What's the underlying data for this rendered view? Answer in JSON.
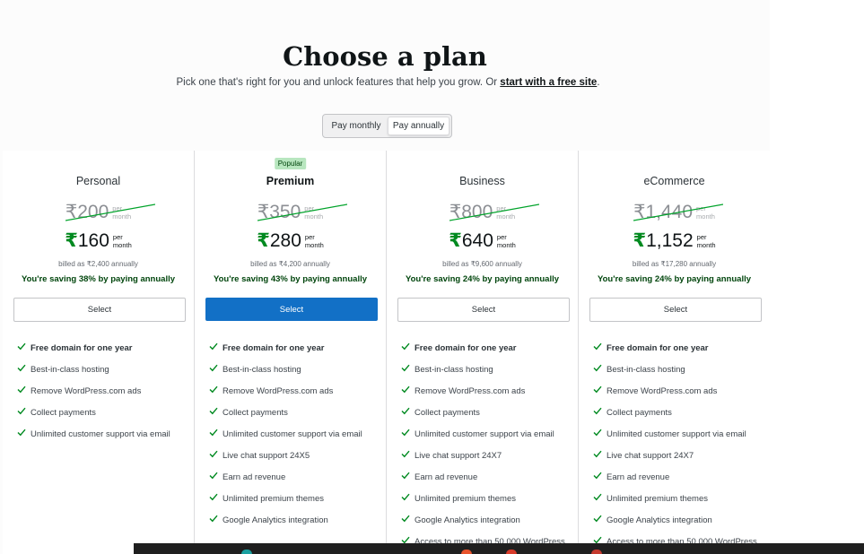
{
  "header": {
    "title": "Choose a plan",
    "subtitle_prefix": "Pick one that's right for you and unlock features that help you grow. Or ",
    "subtitle_link": "start with a free site",
    "subtitle_suffix": "."
  },
  "billing_toggle": {
    "monthly_label": "Pay monthly",
    "annually_label": "Pay annually",
    "selected": "annually"
  },
  "currency_symbol": "₹",
  "per_label": "per",
  "month_label": "month",
  "plans": [
    {
      "name": "Personal",
      "badge": "",
      "old_price": "200",
      "new_price": "160",
      "billed": "billed as ₹2,400 annually",
      "saving": "You're saving 38% by paying annually",
      "select_label": "Select",
      "features": [
        "Free domain for one year",
        "Best-in-class hosting",
        "Remove WordPress.com ads",
        "Collect payments",
        "Unlimited customer support via email"
      ]
    },
    {
      "name": "Premium",
      "badge": "Popular",
      "old_price": "350",
      "new_price": "280",
      "billed": "billed as ₹4,200 annually",
      "saving": "You're saving 43% by paying annually",
      "select_label": "Select",
      "features": [
        "Free domain for one year",
        "Best-in-class hosting",
        "Remove WordPress.com ads",
        "Collect payments",
        "Unlimited customer support via email",
        "Live chat support 24X5",
        "Earn ad revenue",
        "Unlimited premium themes",
        "Google Analytics integration"
      ]
    },
    {
      "name": "Business",
      "badge": "",
      "old_price": "800",
      "new_price": "640",
      "billed": "billed as ₹9,600 annually",
      "saving": "You're saving 24% by paying annually",
      "select_label": "Select",
      "features": [
        "Free domain for one year",
        "Best-in-class hosting",
        "Remove WordPress.com ads",
        "Collect payments",
        "Unlimited customer support via email",
        "Live chat support 24X7",
        "Earn ad revenue",
        "Unlimited premium themes",
        "Google Analytics integration",
        "Access to more than 50,000 WordPress"
      ]
    },
    {
      "name": "eCommerce",
      "badge": "",
      "old_price": "1,440",
      "new_price": "1,152",
      "billed": "billed as ₹17,280 annually",
      "saving": "You're saving 24% by paying annually",
      "select_label": "Select",
      "features": [
        "Free domain for one year",
        "Best-in-class hosting",
        "Remove WordPress.com ads",
        "Collect payments",
        "Unlimited customer support via email",
        "Live chat support 24X7",
        "Earn ad revenue",
        "Unlimited premium themes",
        "Google Analytics integration",
        "Access to more than 50,000 WordPress"
      ]
    }
  ],
  "icons": {
    "check": "checkmark-icon"
  },
  "colors": {
    "accent": "#1270c6",
    "check": "#008a20",
    "strike": "#00a32a",
    "badge_bg": "#b8e6bf"
  }
}
